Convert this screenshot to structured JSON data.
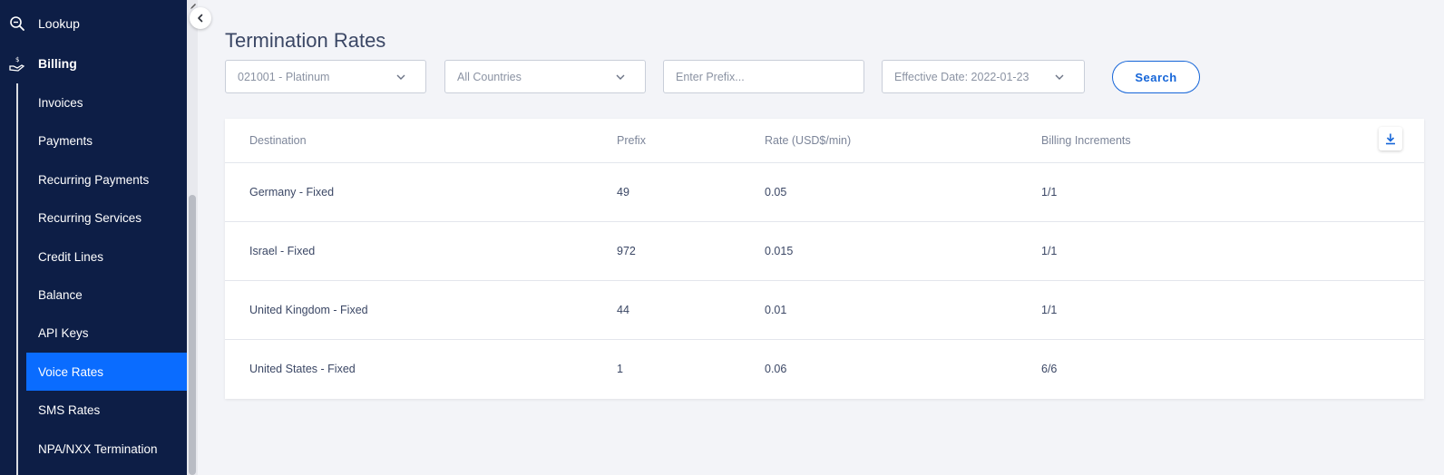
{
  "sidebar": {
    "top_items": [
      {
        "label": "Lookup",
        "icon": "search-magnify-icon"
      },
      {
        "label": "Billing",
        "icon": "billing-hand-icon"
      }
    ],
    "billing_items": [
      {
        "label": "Invoices"
      },
      {
        "label": "Payments"
      },
      {
        "label": "Recurring Payments"
      },
      {
        "label": "Recurring Services"
      },
      {
        "label": "Credit Lines"
      },
      {
        "label": "Balance"
      },
      {
        "label": "API Keys"
      },
      {
        "label": "Voice Rates",
        "active": true
      },
      {
        "label": "SMS Rates"
      },
      {
        "label": "NPA/NXX Termination"
      }
    ],
    "active_color": "#0a6cff",
    "bg_color": "#0d1e46"
  },
  "page": {
    "title": "Termination Rates"
  },
  "filters": {
    "plan": {
      "value": "021001 - Platinum",
      "icon": "chevron-down-icon"
    },
    "country": {
      "value": "All Countries",
      "icon": "chevron-down-icon"
    },
    "prefix": {
      "placeholder": "Enter Prefix...",
      "value": ""
    },
    "effective_date": {
      "value": "Effective Date: 2022-01-23",
      "icon": "chevron-down-icon"
    },
    "search_label": "Search"
  },
  "table": {
    "columns": [
      "Destination",
      "Prefix",
      "Rate (USD$/min)",
      "Billing Increments"
    ],
    "rows": [
      [
        "Germany - Fixed",
        "49",
        "0.05",
        "1/1"
      ],
      [
        "Israel - Fixed",
        "972",
        "0.015",
        "1/1"
      ],
      [
        "United Kingdom - Fixed",
        "44",
        "0.01",
        "1/1"
      ],
      [
        "United States - Fixed",
        "1",
        "0.06",
        "6/6"
      ]
    ],
    "download_icon": "download-icon"
  },
  "colors": {
    "accent": "#1565d8",
    "text": "#3b4765",
    "muted": "#7c8599"
  }
}
